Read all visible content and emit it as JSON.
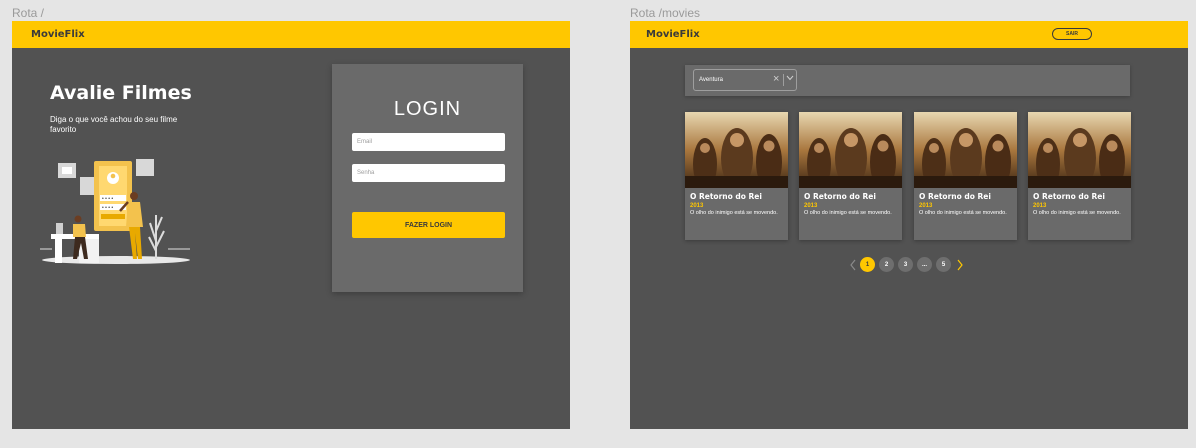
{
  "login_frame": {
    "frame_label": "Rota /",
    "brand": "MovieFlix",
    "hero_title": "Avalie Filmes",
    "hero_subtitle": "Diga o que você achou do seu filme favorito",
    "login": {
      "title": "LOGIN",
      "email_placeholder": "Email",
      "password_placeholder": "Senha",
      "button_label": "FAZER LOGIN"
    }
  },
  "movies_frame": {
    "frame_label": "Rota /movies",
    "brand": "MovieFlix",
    "logout_label": "SAIR",
    "filter": {
      "selected_genre": "Aventura"
    },
    "movies": [
      {
        "title": "O Retorno do Rei",
        "year": "2013",
        "description": "O olho do inimigo está se movendo."
      },
      {
        "title": "O Retorno do Rei",
        "year": "2013",
        "description": "O olho do inimigo está se movendo."
      },
      {
        "title": "O Retorno do Rei",
        "year": "2013",
        "description": "O olho do inimigo está se movendo."
      },
      {
        "title": "O Retorno do Rei",
        "year": "2013",
        "description": "O olho do inimigo está se movendo."
      }
    ],
    "pagination": {
      "pages": [
        "1",
        "2",
        "3",
        "...",
        "5"
      ],
      "current": "1"
    }
  },
  "colors": {
    "accent": "#FFC700",
    "background": "#525252",
    "card": "#6A6A6A",
    "canvas": "#E5E5E5"
  },
  "icons": [
    "close-icon",
    "chevron-down-icon",
    "chevron-left-icon",
    "chevron-right-icon"
  ]
}
